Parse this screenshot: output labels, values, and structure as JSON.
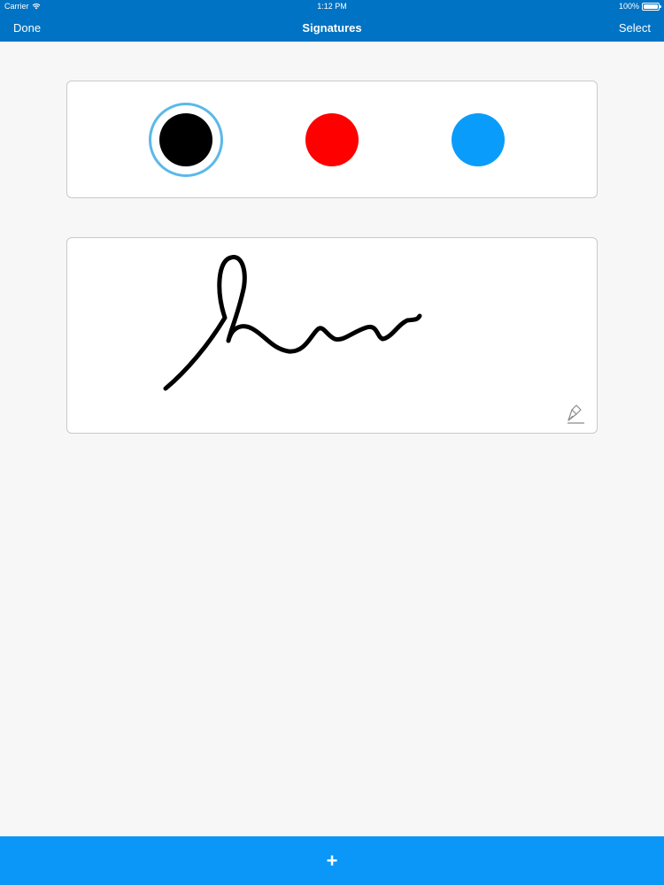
{
  "status_bar": {
    "carrier": "Carrier",
    "time": "1:12 PM",
    "battery": "100%",
    "battery_level": 1.0
  },
  "nav": {
    "left_label": "Done",
    "title": "Signatures",
    "right_label": "Select"
  },
  "colors": {
    "nav_background": "#0073c4",
    "bottom_bar": "#0a97f7",
    "selection_ring": "#5ab9e9",
    "ink": "#000000"
  },
  "color_picker": {
    "selected": "black",
    "swatches": [
      {
        "name": "black",
        "color": "#000000"
      },
      {
        "name": "red",
        "color": "#fe0000"
      },
      {
        "name": "blue",
        "color": "#0a9cfa"
      }
    ]
  },
  "signature": {
    "ink_color": "#000000",
    "edit_icon": "pen-edit-icon"
  },
  "toolbar": {
    "add_label": "+",
    "add_icon": "plus-icon"
  }
}
